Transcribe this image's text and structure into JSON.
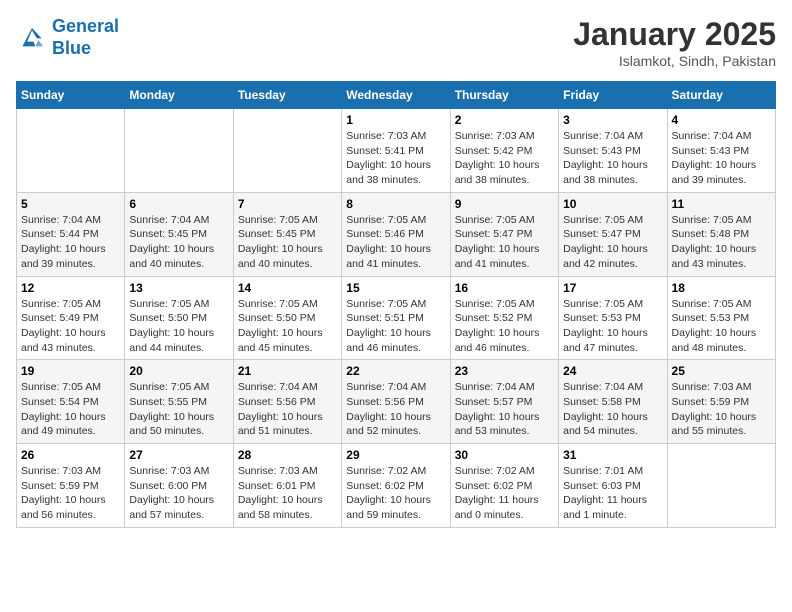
{
  "header": {
    "logo_line1": "General",
    "logo_line2": "Blue",
    "month": "January 2025",
    "location": "Islamkot, Sindh, Pakistan"
  },
  "weekdays": [
    "Sunday",
    "Monday",
    "Tuesday",
    "Wednesday",
    "Thursday",
    "Friday",
    "Saturday"
  ],
  "weeks": [
    [
      {
        "day": "",
        "sunrise": "",
        "sunset": "",
        "daylight": ""
      },
      {
        "day": "",
        "sunrise": "",
        "sunset": "",
        "daylight": ""
      },
      {
        "day": "",
        "sunrise": "",
        "sunset": "",
        "daylight": ""
      },
      {
        "day": "1",
        "sunrise": "Sunrise: 7:03 AM",
        "sunset": "Sunset: 5:41 PM",
        "daylight": "Daylight: 10 hours and 38 minutes."
      },
      {
        "day": "2",
        "sunrise": "Sunrise: 7:03 AM",
        "sunset": "Sunset: 5:42 PM",
        "daylight": "Daylight: 10 hours and 38 minutes."
      },
      {
        "day": "3",
        "sunrise": "Sunrise: 7:04 AM",
        "sunset": "Sunset: 5:43 PM",
        "daylight": "Daylight: 10 hours and 38 minutes."
      },
      {
        "day": "4",
        "sunrise": "Sunrise: 7:04 AM",
        "sunset": "Sunset: 5:43 PM",
        "daylight": "Daylight: 10 hours and 39 minutes."
      }
    ],
    [
      {
        "day": "5",
        "sunrise": "Sunrise: 7:04 AM",
        "sunset": "Sunset: 5:44 PM",
        "daylight": "Daylight: 10 hours and 39 minutes."
      },
      {
        "day": "6",
        "sunrise": "Sunrise: 7:04 AM",
        "sunset": "Sunset: 5:45 PM",
        "daylight": "Daylight: 10 hours and 40 minutes."
      },
      {
        "day": "7",
        "sunrise": "Sunrise: 7:05 AM",
        "sunset": "Sunset: 5:45 PM",
        "daylight": "Daylight: 10 hours and 40 minutes."
      },
      {
        "day": "8",
        "sunrise": "Sunrise: 7:05 AM",
        "sunset": "Sunset: 5:46 PM",
        "daylight": "Daylight: 10 hours and 41 minutes."
      },
      {
        "day": "9",
        "sunrise": "Sunrise: 7:05 AM",
        "sunset": "Sunset: 5:47 PM",
        "daylight": "Daylight: 10 hours and 41 minutes."
      },
      {
        "day": "10",
        "sunrise": "Sunrise: 7:05 AM",
        "sunset": "Sunset: 5:47 PM",
        "daylight": "Daylight: 10 hours and 42 minutes."
      },
      {
        "day": "11",
        "sunrise": "Sunrise: 7:05 AM",
        "sunset": "Sunset: 5:48 PM",
        "daylight": "Daylight: 10 hours and 43 minutes."
      }
    ],
    [
      {
        "day": "12",
        "sunrise": "Sunrise: 7:05 AM",
        "sunset": "Sunset: 5:49 PM",
        "daylight": "Daylight: 10 hours and 43 minutes."
      },
      {
        "day": "13",
        "sunrise": "Sunrise: 7:05 AM",
        "sunset": "Sunset: 5:50 PM",
        "daylight": "Daylight: 10 hours and 44 minutes."
      },
      {
        "day": "14",
        "sunrise": "Sunrise: 7:05 AM",
        "sunset": "Sunset: 5:50 PM",
        "daylight": "Daylight: 10 hours and 45 minutes."
      },
      {
        "day": "15",
        "sunrise": "Sunrise: 7:05 AM",
        "sunset": "Sunset: 5:51 PM",
        "daylight": "Daylight: 10 hours and 46 minutes."
      },
      {
        "day": "16",
        "sunrise": "Sunrise: 7:05 AM",
        "sunset": "Sunset: 5:52 PM",
        "daylight": "Daylight: 10 hours and 46 minutes."
      },
      {
        "day": "17",
        "sunrise": "Sunrise: 7:05 AM",
        "sunset": "Sunset: 5:53 PM",
        "daylight": "Daylight: 10 hours and 47 minutes."
      },
      {
        "day": "18",
        "sunrise": "Sunrise: 7:05 AM",
        "sunset": "Sunset: 5:53 PM",
        "daylight": "Daylight: 10 hours and 48 minutes."
      }
    ],
    [
      {
        "day": "19",
        "sunrise": "Sunrise: 7:05 AM",
        "sunset": "Sunset: 5:54 PM",
        "daylight": "Daylight: 10 hours and 49 minutes."
      },
      {
        "day": "20",
        "sunrise": "Sunrise: 7:05 AM",
        "sunset": "Sunset: 5:55 PM",
        "daylight": "Daylight: 10 hours and 50 minutes."
      },
      {
        "day": "21",
        "sunrise": "Sunrise: 7:04 AM",
        "sunset": "Sunset: 5:56 PM",
        "daylight": "Daylight: 10 hours and 51 minutes."
      },
      {
        "day": "22",
        "sunrise": "Sunrise: 7:04 AM",
        "sunset": "Sunset: 5:56 PM",
        "daylight": "Daylight: 10 hours and 52 minutes."
      },
      {
        "day": "23",
        "sunrise": "Sunrise: 7:04 AM",
        "sunset": "Sunset: 5:57 PM",
        "daylight": "Daylight: 10 hours and 53 minutes."
      },
      {
        "day": "24",
        "sunrise": "Sunrise: 7:04 AM",
        "sunset": "Sunset: 5:58 PM",
        "daylight": "Daylight: 10 hours and 54 minutes."
      },
      {
        "day": "25",
        "sunrise": "Sunrise: 7:03 AM",
        "sunset": "Sunset: 5:59 PM",
        "daylight": "Daylight: 10 hours and 55 minutes."
      }
    ],
    [
      {
        "day": "26",
        "sunrise": "Sunrise: 7:03 AM",
        "sunset": "Sunset: 5:59 PM",
        "daylight": "Daylight: 10 hours and 56 minutes."
      },
      {
        "day": "27",
        "sunrise": "Sunrise: 7:03 AM",
        "sunset": "Sunset: 6:00 PM",
        "daylight": "Daylight: 10 hours and 57 minutes."
      },
      {
        "day": "28",
        "sunrise": "Sunrise: 7:03 AM",
        "sunset": "Sunset: 6:01 PM",
        "daylight": "Daylight: 10 hours and 58 minutes."
      },
      {
        "day": "29",
        "sunrise": "Sunrise: 7:02 AM",
        "sunset": "Sunset: 6:02 PM",
        "daylight": "Daylight: 10 hours and 59 minutes."
      },
      {
        "day": "30",
        "sunrise": "Sunrise: 7:02 AM",
        "sunset": "Sunset: 6:02 PM",
        "daylight": "Daylight: 11 hours and 0 minutes."
      },
      {
        "day": "31",
        "sunrise": "Sunrise: 7:01 AM",
        "sunset": "Sunset: 6:03 PM",
        "daylight": "Daylight: 11 hours and 1 minute."
      },
      {
        "day": "",
        "sunrise": "",
        "sunset": "",
        "daylight": ""
      }
    ]
  ]
}
